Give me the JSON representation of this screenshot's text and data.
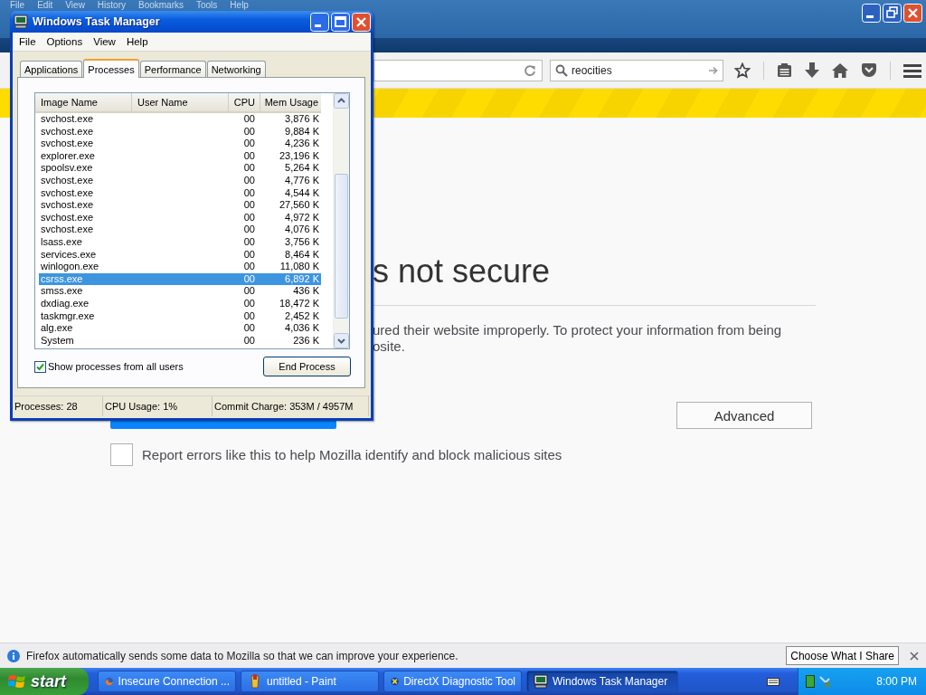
{
  "browser": {
    "menu": [
      "File",
      "Edit",
      "View",
      "History",
      "Bookmarks",
      "Tools",
      "Help"
    ],
    "search": {
      "value": "reocities"
    },
    "page": {
      "heading": "s not secure",
      "paragraph": [
        "ured their website improperly. To protect your information from being",
        "osite."
      ],
      "advanced_button": "Advanced",
      "report_checkbox": {
        "label": "Report errors like this to help Mozilla identify and block malicious sites",
        "checked": false
      }
    },
    "notification": {
      "text": "Firefox automatically sends some data to Mozilla so that we can improve your experience.",
      "button": "Choose What I Share"
    }
  },
  "task_manager": {
    "title": "Windows Task Manager",
    "menu": [
      "File",
      "Options",
      "View",
      "Help"
    ],
    "tabs": [
      {
        "label": "Applications",
        "selected": false
      },
      {
        "label": "Processes",
        "selected": true
      },
      {
        "label": "Performance",
        "selected": false
      },
      {
        "label": "Networking",
        "selected": false
      }
    ],
    "columns": [
      "Image Name",
      "User Name",
      "CPU",
      "Mem Usage"
    ],
    "rows": [
      {
        "image_name": "svchost.exe",
        "cpu": "00",
        "mem_usage": "3,876 K",
        "selected": false
      },
      {
        "image_name": "svchost.exe",
        "cpu": "00",
        "mem_usage": "9,884 K",
        "selected": false
      },
      {
        "image_name": "svchost.exe",
        "cpu": "00",
        "mem_usage": "4,236 K",
        "selected": false
      },
      {
        "image_name": "explorer.exe",
        "cpu": "00",
        "mem_usage": "23,196 K",
        "selected": false
      },
      {
        "image_name": "spoolsv.exe",
        "cpu": "00",
        "mem_usage": "5,264 K",
        "selected": false
      },
      {
        "image_name": "svchost.exe",
        "cpu": "00",
        "mem_usage": "4,776 K",
        "selected": false
      },
      {
        "image_name": "svchost.exe",
        "cpu": "00",
        "mem_usage": "4,544 K",
        "selected": false
      },
      {
        "image_name": "svchost.exe",
        "cpu": "00",
        "mem_usage": "27,560 K",
        "selected": false
      },
      {
        "image_name": "svchost.exe",
        "cpu": "00",
        "mem_usage": "4,972 K",
        "selected": false
      },
      {
        "image_name": "svchost.exe",
        "cpu": "00",
        "mem_usage": "4,076 K",
        "selected": false
      },
      {
        "image_name": "lsass.exe",
        "cpu": "00",
        "mem_usage": "3,756 K",
        "selected": false
      },
      {
        "image_name": "services.exe",
        "cpu": "00",
        "mem_usage": "8,464 K",
        "selected": false
      },
      {
        "image_name": "winlogon.exe",
        "cpu": "00",
        "mem_usage": "11,080 K",
        "selected": false
      },
      {
        "image_name": "csrss.exe",
        "cpu": "00",
        "mem_usage": "6,892 K",
        "selected": true
      },
      {
        "image_name": "smss.exe",
        "cpu": "00",
        "mem_usage": "436 K",
        "selected": false
      },
      {
        "image_name": "dxdiag.exe",
        "cpu": "00",
        "mem_usage": "18,472 K",
        "selected": false
      },
      {
        "image_name": "taskmgr.exe",
        "cpu": "00",
        "mem_usage": "2,452 K",
        "selected": false
      },
      {
        "image_name": "alg.exe",
        "cpu": "00",
        "mem_usage": "4,036 K",
        "selected": false
      },
      {
        "image_name": "System",
        "cpu": "00",
        "mem_usage": "236 K",
        "selected": false
      }
    ],
    "show_all_users": {
      "label": "Show processes from all users",
      "checked": true
    },
    "end_process_button": "End Process",
    "status_bar": [
      "Processes: 28",
      "CPU Usage: 1%",
      "Commit Charge: 353M / 4957M"
    ]
  },
  "taskbar": {
    "start": "start",
    "tasks": [
      {
        "kind": "firefox",
        "label": "Insecure Connection ...",
        "selected": false
      },
      {
        "kind": "paint",
        "label": "untitled - Paint",
        "selected": false
      },
      {
        "kind": "directx",
        "label": "DirectX Diagnostic Tool",
        "selected": false
      },
      {
        "kind": "taskmgr",
        "label": "Windows Task Manager",
        "selected": true
      }
    ],
    "clock": "8:00 PM"
  }
}
